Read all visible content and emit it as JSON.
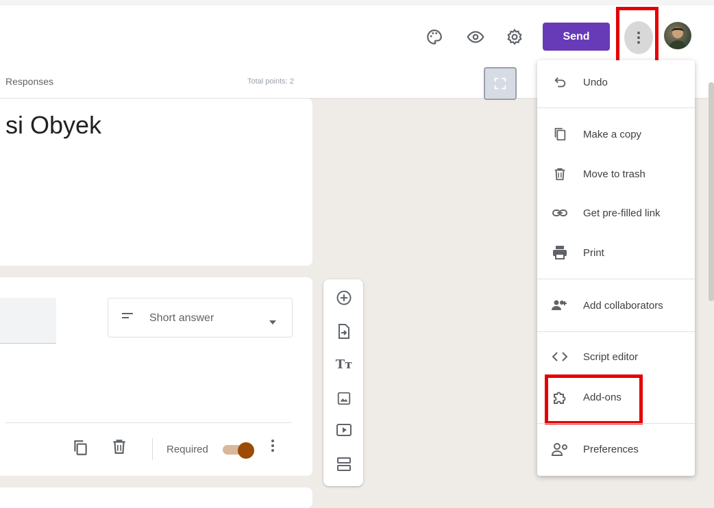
{
  "header": {
    "send_label": "Send",
    "icons": [
      "palette-icon",
      "eye-icon",
      "gear-icon",
      "more-vert-icon"
    ]
  },
  "tabs": {
    "responses": "Responses"
  },
  "total_points": "Total points: 2",
  "form": {
    "title": "si Obyek"
  },
  "question": {
    "type_label": "Short answer",
    "required_label": "Required",
    "required_on": true
  },
  "menu": {
    "items": [
      {
        "label": "Undo",
        "icon": "undo-icon"
      },
      {
        "label": "Make a copy",
        "icon": "copy-icon"
      },
      {
        "label": "Move to trash",
        "icon": "trash-icon"
      },
      {
        "label": "Get pre-filled link",
        "icon": "link-icon"
      },
      {
        "label": "Print",
        "icon": "print-icon"
      },
      {
        "label": "Add collaborators",
        "icon": "collaborators-icon"
      },
      {
        "label": "Script editor",
        "icon": "code-icon"
      },
      {
        "label": "Add-ons",
        "icon": "puzzle-icon"
      },
      {
        "label": "Preferences",
        "icon": "preferences-icon"
      }
    ]
  },
  "colors": {
    "accent": "#673ab7",
    "highlight": "#e40000",
    "toggle": "#9b4b06",
    "background": "#efebe6"
  }
}
